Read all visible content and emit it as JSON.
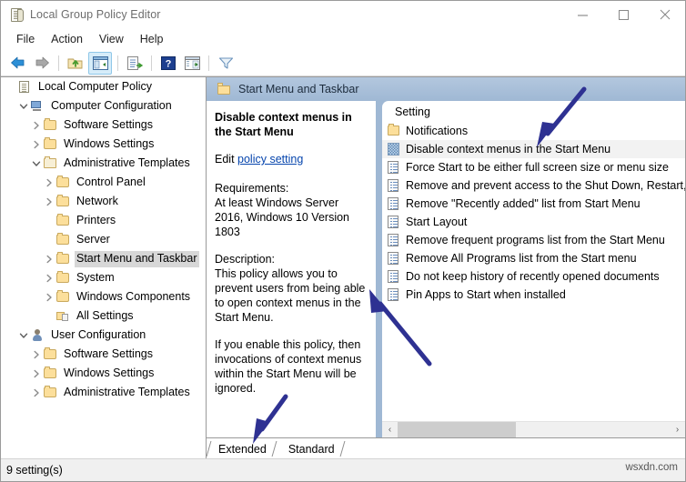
{
  "window": {
    "title": "Local Group Policy Editor",
    "title_icon": "policy-document-icon",
    "minimize_label": "—",
    "maximize_label": "□",
    "close_label": "✕"
  },
  "menubar": {
    "items": [
      {
        "label": "File"
      },
      {
        "label": "Action"
      },
      {
        "label": "View"
      },
      {
        "label": "Help"
      }
    ]
  },
  "toolbar": {
    "buttons": [
      {
        "name": "back-icon",
        "title": "Back"
      },
      {
        "name": "forward-icon",
        "title": "Forward"
      },
      {
        "name": "up-folder-icon",
        "title": "Up One Level"
      },
      {
        "name": "show-hide-tree-icon",
        "title": "Show/Hide Console Tree"
      },
      {
        "name": "export-list-icon",
        "title": "Export List"
      },
      {
        "name": "help-icon",
        "title": "Help"
      },
      {
        "name": "show-action-pane-icon",
        "title": "Show/Hide Action Pane"
      },
      {
        "name": "filter-icon",
        "title": "Filter"
      }
    ]
  },
  "tree": {
    "nodes": [
      {
        "label": "Local Computer Policy",
        "indent": 0,
        "chevron": "none",
        "icon": "policy-icon",
        "selected": false
      },
      {
        "label": "Computer Configuration",
        "indent": 1,
        "chevron": "expanded",
        "icon": "computer-icon",
        "selected": false
      },
      {
        "label": "Software Settings",
        "indent": 2,
        "chevron": "collapsed",
        "icon": "folder-icon",
        "selected": false
      },
      {
        "label": "Windows Settings",
        "indent": 2,
        "chevron": "collapsed",
        "icon": "folder-icon",
        "selected": false
      },
      {
        "label": "Administrative Templates",
        "indent": 2,
        "chevron": "expanded",
        "icon": "folder-open-icon",
        "selected": false
      },
      {
        "label": "Control Panel",
        "indent": 3,
        "chevron": "collapsed",
        "icon": "folder-icon",
        "selected": false
      },
      {
        "label": "Network",
        "indent": 3,
        "chevron": "collapsed",
        "icon": "folder-icon",
        "selected": false
      },
      {
        "label": "Printers",
        "indent": 3,
        "chevron": "none",
        "icon": "folder-icon",
        "selected": false
      },
      {
        "label": "Server",
        "indent": 3,
        "chevron": "none",
        "icon": "folder-icon",
        "selected": false
      },
      {
        "label": "Start Menu and Taskbar",
        "indent": 3,
        "chevron": "collapsed",
        "icon": "folder-icon",
        "selected": true
      },
      {
        "label": "System",
        "indent": 3,
        "chevron": "collapsed",
        "icon": "folder-icon",
        "selected": false
      },
      {
        "label": "Windows Components",
        "indent": 3,
        "chevron": "collapsed",
        "icon": "folder-icon",
        "selected": false
      },
      {
        "label": "All Settings",
        "indent": 3,
        "chevron": "none",
        "icon": "all-settings-icon",
        "selected": false
      },
      {
        "label": "User Configuration",
        "indent": 1,
        "chevron": "expanded",
        "icon": "user-icon",
        "selected": false
      },
      {
        "label": "Software Settings",
        "indent": 2,
        "chevron": "collapsed",
        "icon": "folder-icon",
        "selected": false
      },
      {
        "label": "Windows Settings",
        "indent": 2,
        "chevron": "collapsed",
        "icon": "folder-icon",
        "selected": false
      },
      {
        "label": "Administrative Templates",
        "indent": 2,
        "chevron": "collapsed",
        "icon": "folder-icon",
        "selected": false
      }
    ]
  },
  "pane_header": {
    "title": "Start Menu and Taskbar",
    "icon": "folder-icon"
  },
  "detail": {
    "setting_title": "Disable context menus in the Start Menu",
    "edit_prefix": "Edit ",
    "edit_link": "policy setting ",
    "requirements_label": "Requirements:",
    "requirements_text": "At least Windows Server 2016, Windows 10 Version 1803",
    "description_label": "Description:",
    "description_text": "This policy allows you to prevent users from being able to open context menus in the Start Menu.",
    "description_text2": "If you enable this policy, then invocations of context menus within the Start Menu will be ignored."
  },
  "list": {
    "column_header": "Setting",
    "rows": [
      {
        "label": "Notifications",
        "icon": "folder-icon",
        "selected": false
      },
      {
        "label": "Disable context menus in the Start Menu",
        "icon": "selected-setting-icon",
        "selected": true
      },
      {
        "label": "Force Start to be either full screen size or menu size",
        "icon": "setting-icon",
        "selected": false
      },
      {
        "label": "Remove and prevent access to the Shut Down, Restart,",
        "icon": "setting-icon",
        "selected": false
      },
      {
        "label": "Remove \"Recently added\" list from Start Menu",
        "icon": "setting-icon",
        "selected": false
      },
      {
        "label": "Start Layout",
        "icon": "setting-icon",
        "selected": false
      },
      {
        "label": "Remove frequent programs list from the Start Menu",
        "icon": "setting-icon",
        "selected": false
      },
      {
        "label": "Remove All Programs list from the Start menu",
        "icon": "setting-icon",
        "selected": false
      },
      {
        "label": "Do not keep history of recently opened documents",
        "icon": "setting-icon",
        "selected": false
      },
      {
        "label": "Pin Apps to Start when installed",
        "icon": "setting-icon",
        "selected": false
      }
    ],
    "scroll_left_icon": "‹",
    "scroll_right_icon": "›"
  },
  "tabs": [
    {
      "label": "Extended",
      "active": true
    },
    {
      "label": "Standard",
      "active": false
    }
  ],
  "statusbar": {
    "text": "9 setting(s)",
    "watermark": "wsxdn.com"
  },
  "annotations": {
    "arrow_color": "#2e3192",
    "arrows": [
      {
        "name": "arrow-to-selected-setting"
      },
      {
        "name": "arrow-to-description"
      },
      {
        "name": "arrow-to-extended-tab"
      }
    ]
  }
}
